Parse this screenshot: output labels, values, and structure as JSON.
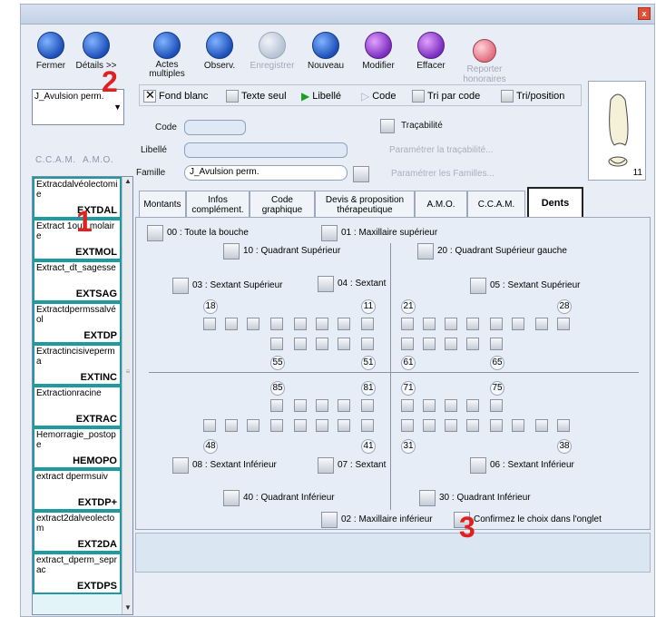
{
  "toolbar": {
    "fermer": "Fermer",
    "details": "Détails >>",
    "actes": "Actes\nmultiples",
    "observ": "Observ.",
    "enregistrer": "Enregistrer",
    "nouveau": "Nouveau",
    "modifier": "Modifier",
    "effacer": "Effacer",
    "reporter_hon": "Reporter\nhonoraires"
  },
  "family_dropdown": "J_Avulsion perm.",
  "left_labels": {
    "ccam": "C.C.A.M.",
    "amo": "A.M.O."
  },
  "acts": [
    {
      "name": "Extracdalvéolectomie",
      "code": "EXTDAL"
    },
    {
      "name": "Extract 1ou2 molaire",
      "code": "EXTMOL"
    },
    {
      "name": "Extract_dt_sagesse",
      "code": "EXTSAG"
    },
    {
      "name": "Extractdpermssalvéol",
      "code": "EXTDP"
    },
    {
      "name": "Extractincisivepermа",
      "code": "EXTINC"
    },
    {
      "name": "Extractionracine",
      "code": "EXTRAC"
    },
    {
      "name": "Hemorragie_postope",
      "code": "HEMOPO"
    },
    {
      "name": "extract dpermsuiv",
      "code": "EXTDP+"
    },
    {
      "name": "extract2dalveolectom",
      "code": "EXT2DA"
    },
    {
      "name": "extract_dperm_seprac",
      "code": "EXTDPS"
    }
  ],
  "options": {
    "fond_blanc": "Fond blanc",
    "texte_seul": "Texte seul",
    "libelle": "Libellé",
    "code": "Code",
    "tri_code": "Tri par code",
    "tri_position": "Tri/position"
  },
  "form": {
    "code_label": "Code",
    "libelle_label": "Libellé",
    "famille_label": "Famille",
    "famille_value": "J_Avulsion perm.",
    "tracabilite": "Traçabilité",
    "param_trac": "Paramétrer la traçabilité...",
    "param_fam": "Paramétrer les Familles..."
  },
  "tooth_count": "11",
  "tabs": [
    {
      "label": "Montants"
    },
    {
      "label": "Infos\ncomplément."
    },
    {
      "label": "Code\ngraphique"
    },
    {
      "label": "Devis & proposition\nthérapeutique"
    },
    {
      "label": "A.M.O."
    },
    {
      "label": "C.C.A.M."
    },
    {
      "label": "Dents"
    }
  ],
  "teeth_panel": {
    "toute_bouche": "00 : Toute la bouche",
    "max_sup": "01 : Maxillaire supérieur",
    "quad_sup": "10 : Quadrant Supérieur",
    "quad_sup_g": "20 : Quadrant Supérieur gauche",
    "sext_sup_03": "03 : Sextant Supérieur",
    "sext_04": "04 : Sextant",
    "sext_sup_05": "05 : Sextant Supérieur",
    "sext_inf_08": "08 : Sextant Inférieur",
    "sext_07": "07 : Sextant",
    "sext_inf_06": "06 : Sextant Inférieur",
    "quad_inf_40": "40 : Quadrant Inférieur",
    "quad_inf_30": "30 : Quadrant Inférieur",
    "max_inf": "02 : Maxillaire inférieur",
    "confirm": "Confirmez le choix dans l'onglet",
    "tooth_numbers": {
      "t18": "18",
      "t11": "11",
      "t21": "21",
      "t28": "28",
      "t55": "55",
      "t51": "51",
      "t61": "61",
      "t65": "65",
      "t85": "85",
      "t81": "81",
      "t71": "71",
      "t75": "75",
      "t48": "48",
      "t41": "41",
      "t31": "31",
      "t38": "38"
    }
  },
  "callouts": {
    "c1": "1",
    "c2": "2",
    "c3": "3"
  }
}
